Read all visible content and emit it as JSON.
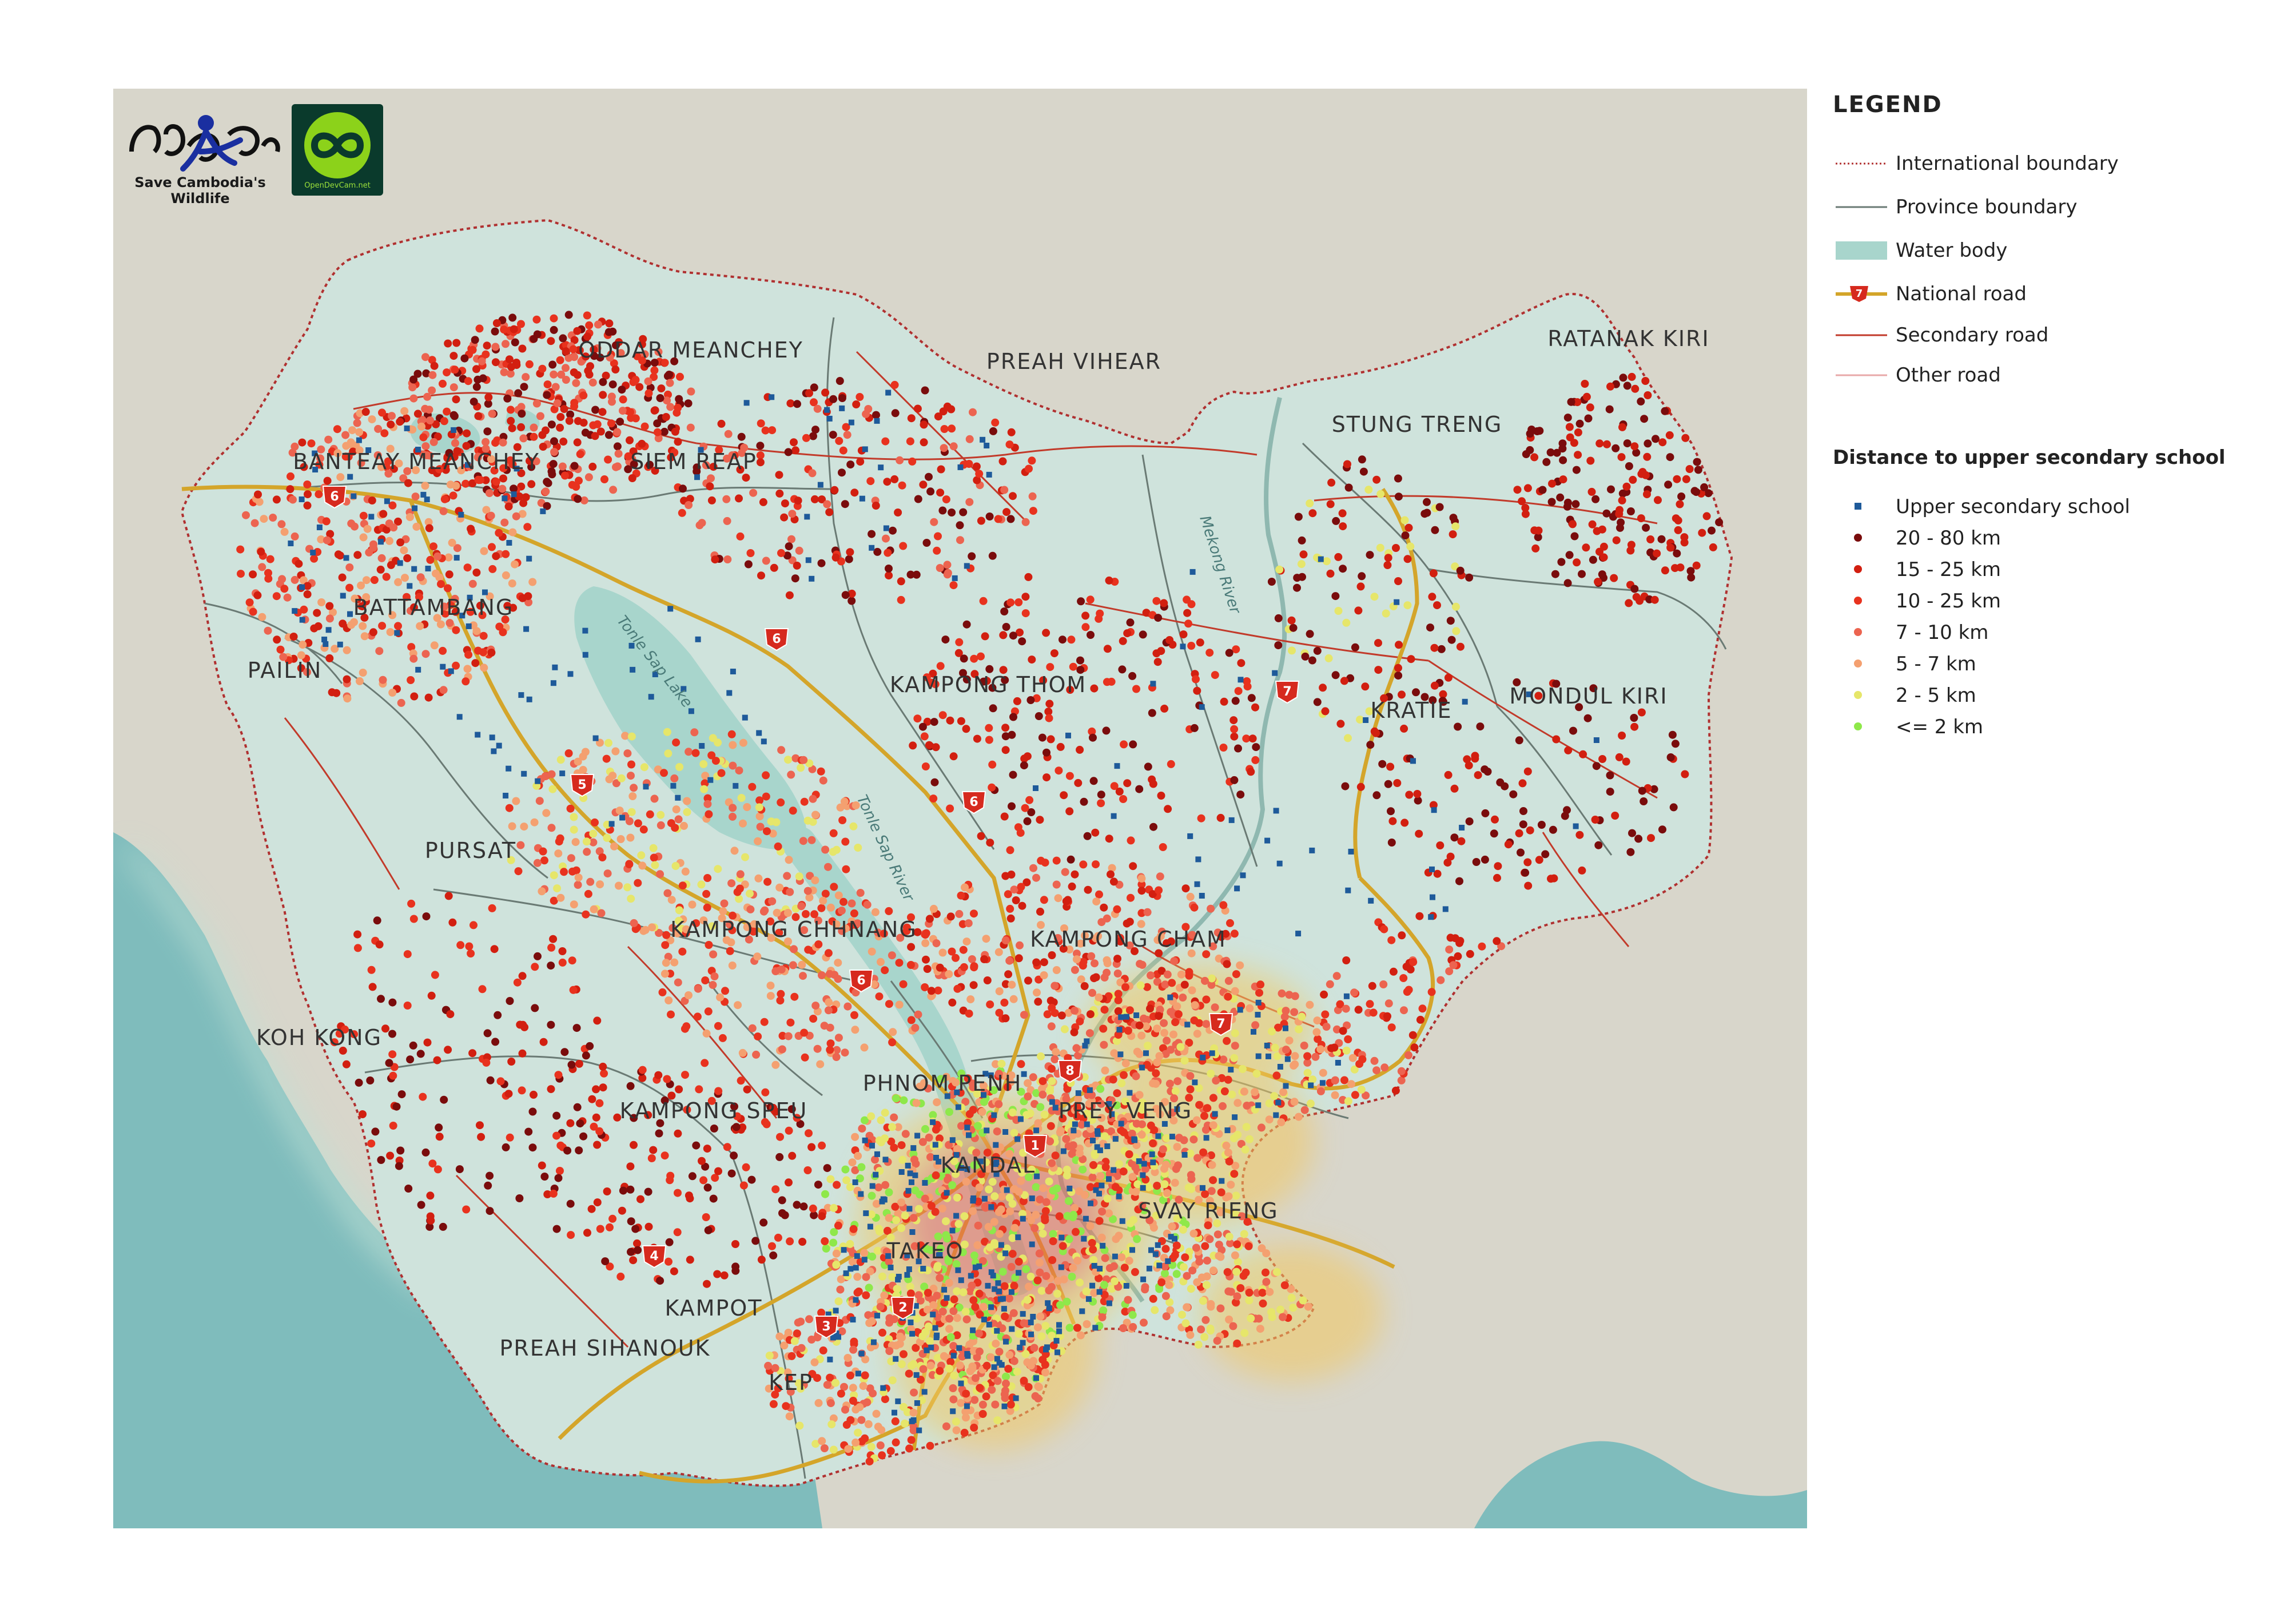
{
  "logos": {
    "scw_caption": "Save Cambodia's Wildlife",
    "odc_caption": "OpenDevCam.net"
  },
  "map": {
    "provinces": [
      {
        "name": "ODDAR MEANCHEY"
      },
      {
        "name": "PREAH VIHEAR"
      },
      {
        "name": "STUNG TRENG"
      },
      {
        "name": "RATANAK KIRI"
      },
      {
        "name": "BANTEAY MEANCHEY"
      },
      {
        "name": "SIEM REAP"
      },
      {
        "name": "BATTAMBANG"
      },
      {
        "name": "PAILIN"
      },
      {
        "name": "KAMPONG THOM"
      },
      {
        "name": "KRATIE"
      },
      {
        "name": "MONDUL KIRI"
      },
      {
        "name": "PURSAT"
      },
      {
        "name": "KAMPONG CHHNANG"
      },
      {
        "name": "KAMPONG CHAM"
      },
      {
        "name": "KOH KONG"
      },
      {
        "name": "PHNOM PENH"
      },
      {
        "name": "KAMPONG SPEU"
      },
      {
        "name": "PREY VENG"
      },
      {
        "name": "KANDAL"
      },
      {
        "name": "SVAY RIENG"
      },
      {
        "name": "TAKEO"
      },
      {
        "name": "KAMPOT"
      },
      {
        "name": "PREAH SIHANOUK"
      },
      {
        "name": "KEP"
      }
    ],
    "water_labels": [
      "Tonle Sap Lake",
      "Tonle Sap River",
      "Mekong River"
    ],
    "road_shields": [
      "6",
      "6",
      "6",
      "5",
      "7",
      "7",
      "6",
      "8",
      "1",
      "4",
      "3",
      "2"
    ],
    "colors": {
      "land": "#cfe3dc",
      "surround": "#d9d7cc",
      "sea": "#7fbcbc",
      "water": "#a8d5cc",
      "national_road": "#d4a52a",
      "road_shield": "#d62a1e",
      "school": "#1e5a9a",
      "d20_80": "#7a0c0c",
      "d15_25": "#d21f10",
      "d10_25": "#e8321e",
      "d7_10": "#ec6450",
      "d5_7": "#f4a070",
      "d2_5": "#e6e66a",
      "d_le2": "#8ee84a"
    }
  },
  "legend": {
    "title": "LEGEND",
    "items": [
      {
        "label": "International boundary",
        "icon": "dotted-red-line"
      },
      {
        "label": "Province boundary",
        "icon": "grey-line"
      },
      {
        "label": "Water body",
        "icon": "teal-rect"
      },
      {
        "label": "National road",
        "icon": "yellow-road-with-shield",
        "shield": "7"
      },
      {
        "label": "Secondary road",
        "icon": "red-line"
      },
      {
        "label": "Other road",
        "icon": "pink-line"
      }
    ],
    "distance_title": "Distance to upper secondary school",
    "distance_items": [
      {
        "label": "Upper secondary school",
        "icon": "blue-square"
      },
      {
        "label": "20 - 80 km",
        "icon": "dark-red-dot"
      },
      {
        "label": "15 - 25 km",
        "icon": "red-dot"
      },
      {
        "label": "10 - 25 km",
        "icon": "red-dot"
      },
      {
        "label": "7 - 10 km",
        "icon": "salmon-dot"
      },
      {
        "label": "5 - 7 km",
        "icon": "orange-dot"
      },
      {
        "label": "2 - 5 km",
        "icon": "yellow-dot"
      },
      {
        "label": "<= 2 km",
        "icon": "green-dot"
      }
    ]
  }
}
